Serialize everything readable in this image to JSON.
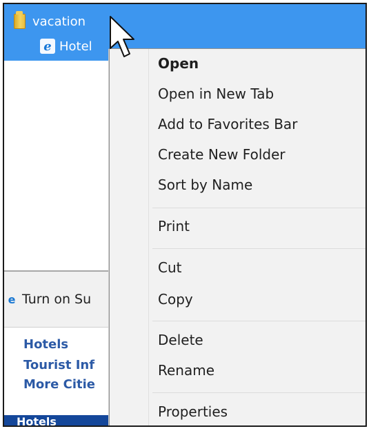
{
  "favorites_panel": {
    "folder_label": "vacation",
    "link_label": "Hotel",
    "suggest_label": "Turn on Su",
    "links": [
      "Hotels",
      "Tourist Inf",
      "More Citie"
    ],
    "bottom_label": "Hotels"
  },
  "context_menu": {
    "items": [
      "Open",
      "Open in New Tab",
      "Add to Favorites Bar",
      "Create New Folder",
      "Sort by Name",
      "Print",
      "Cut",
      "Copy",
      "Delete",
      "Rename",
      "Properties"
    ]
  },
  "colors": {
    "selection": "#3d96ef",
    "menu_bg": "#f2f2f2",
    "link_blue": "#2c5aa6"
  },
  "icons": [
    "folder-icon",
    "ie-page-icon",
    "ie-icon",
    "mouse-cursor-icon"
  ]
}
